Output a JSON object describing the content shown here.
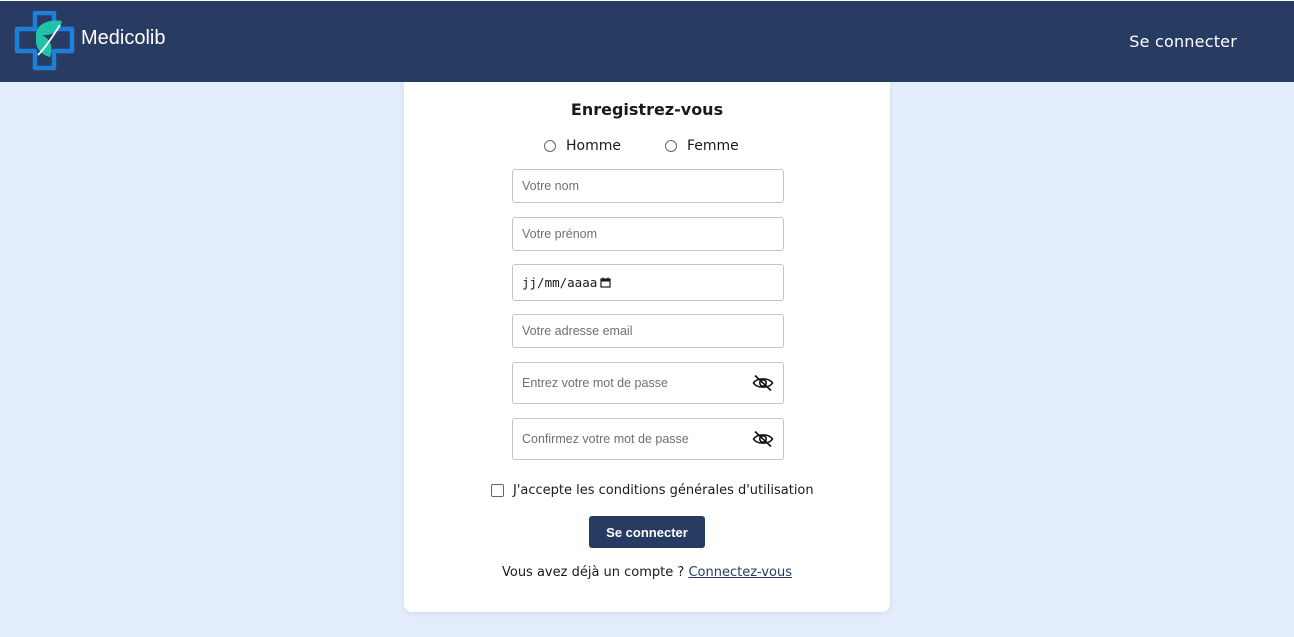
{
  "brand": {
    "name": "Medicolib",
    "logo_icon": "medical-cross-leaf-icon",
    "colors": {
      "primary": "#283b63",
      "logo_blue": "#1e7fd6",
      "logo_teal": "#20c3a8"
    }
  },
  "header": {
    "login_link": "Se connecter"
  },
  "form": {
    "title": "Enregistrez-vous",
    "gender_options": [
      "Homme",
      "Femme"
    ],
    "last_name_placeholder": "Votre nom",
    "first_name_placeholder": "Votre prénom",
    "birthdate_value": "jj/mm/aaaa",
    "email_placeholder": "Votre adresse email",
    "password_placeholder": "Entrez votre mot de passe",
    "confirm_password_placeholder": "Confirmez votre mot de passe",
    "password_toggle_icon": "eye-slash-icon",
    "terms_label": "J'accepte les conditions générales d'utilisation",
    "submit_label": "Se connecter",
    "has_account_text": "Vous avez déjà un compte ?",
    "login_link_text": "Connectez-vous"
  }
}
